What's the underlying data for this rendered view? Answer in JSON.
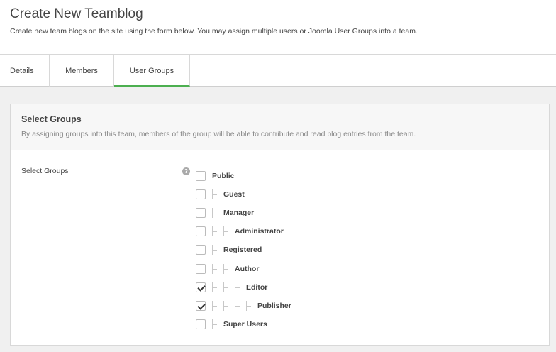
{
  "header": {
    "title": "Create New Teamblog",
    "description": "Create new team blogs on the site using the form below. You may assign multiple users or Joomla User Groups into a team."
  },
  "tabs": [
    {
      "label": "Details",
      "active": false
    },
    {
      "label": "Members",
      "active": false
    },
    {
      "label": "User Groups",
      "active": true
    }
  ],
  "panel": {
    "title": "Select Groups",
    "description": "By assigning groups into this team, members of the group will be able to contribute and read blog entries from the team.",
    "field_label": "Select Groups",
    "help_icon": "?"
  },
  "groups": [
    {
      "name": "Public",
      "depth": 0,
      "checked": false
    },
    {
      "name": "Guest",
      "depth": 1,
      "checked": false
    },
    {
      "name": "Manager",
      "depth": 1,
      "checked": false
    },
    {
      "name": "Administrator",
      "depth": 2,
      "checked": false
    },
    {
      "name": "Registered",
      "depth": 1,
      "checked": false
    },
    {
      "name": "Author",
      "depth": 2,
      "checked": false
    },
    {
      "name": "Editor",
      "depth": 3,
      "checked": true
    },
    {
      "name": "Publisher",
      "depth": 4,
      "checked": true
    },
    {
      "name": "Super Users",
      "depth": 1,
      "checked": false
    }
  ],
  "colors": {
    "active_tab_accent": "#4caf50"
  }
}
